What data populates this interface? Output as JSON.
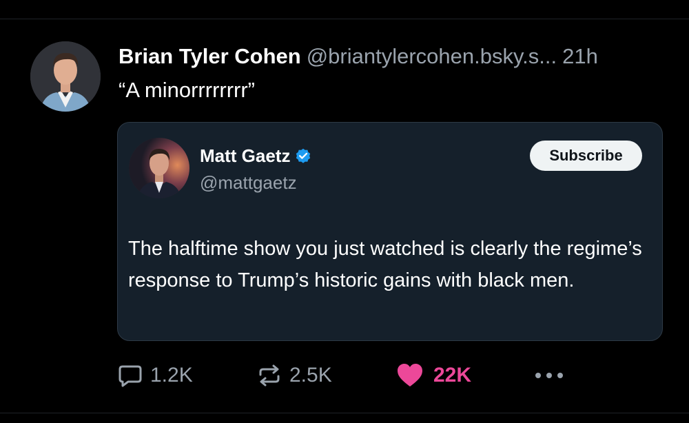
{
  "post": {
    "author_name": "Brian Tyler Cohen",
    "handle": "@briantylercohen.bsky.s...",
    "timestamp": "21h",
    "text": "“A minorrrrrrrr”",
    "avatar_icon": "person-avatar"
  },
  "quoted_post": {
    "author_name": "Matt Gaetz",
    "handle": "@mattgaetz",
    "verified": true,
    "verified_icon": "verified-badge-icon",
    "subscribe_label": "Subscribe",
    "text": "The halftime show you just watched is clearly the regime’s response to Trump’s historic gains with black men."
  },
  "actions": {
    "reply_count": "1.2K",
    "repost_count": "2.5K",
    "like_count": "22K",
    "reply_icon": "comment-icon",
    "repost_icon": "repost-icon",
    "like_icon": "heart-icon",
    "more_icon": "more-dots-icon"
  },
  "colors": {
    "background": "#000000",
    "card_background": "#15202b",
    "secondary_text": "#9aa3ad",
    "like_active": "#ec4899",
    "verified_blue": "#1d9bf0"
  }
}
